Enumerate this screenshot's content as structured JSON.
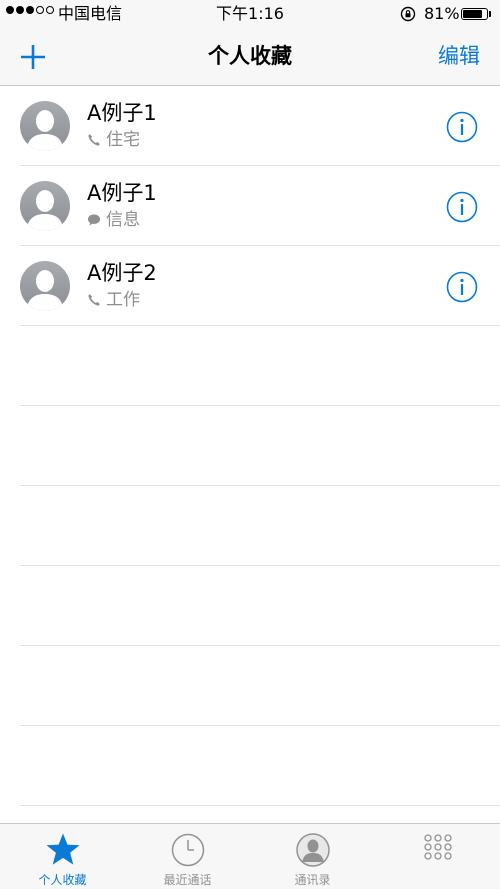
{
  "status_bar": {
    "carrier": "中国电信",
    "time": "下午1:16",
    "battery_percent": "81%",
    "battery_level": 0.81,
    "signal_bars_filled": 3,
    "signal_bars_total": 5
  },
  "nav": {
    "title": "个人收藏",
    "edit_label": "编辑",
    "add_icon": "plus-icon"
  },
  "favorites": [
    {
      "name": "A例子1",
      "type": "住宅",
      "type_icon": "phone-icon"
    },
    {
      "name": "A例子1",
      "type": "信息",
      "type_icon": "message-icon"
    },
    {
      "name": "A例子2",
      "type": "工作",
      "type_icon": "phone-icon"
    }
  ],
  "tab_bar": {
    "tabs": [
      {
        "label": "个人收藏",
        "icon": "star-icon",
        "active": true
      },
      {
        "label": "最近通话",
        "icon": "clock-icon",
        "active": false
      },
      {
        "label": "通讯录",
        "icon": "contacts-icon",
        "active": false
      },
      {
        "label": "",
        "icon": "keypad-icon",
        "active": false
      }
    ]
  },
  "colors": {
    "accent": "#0a7ad6",
    "secondary_text": "#8e8e93",
    "separator": "#e0e0e0",
    "bar_background": "#f7f7f7"
  }
}
